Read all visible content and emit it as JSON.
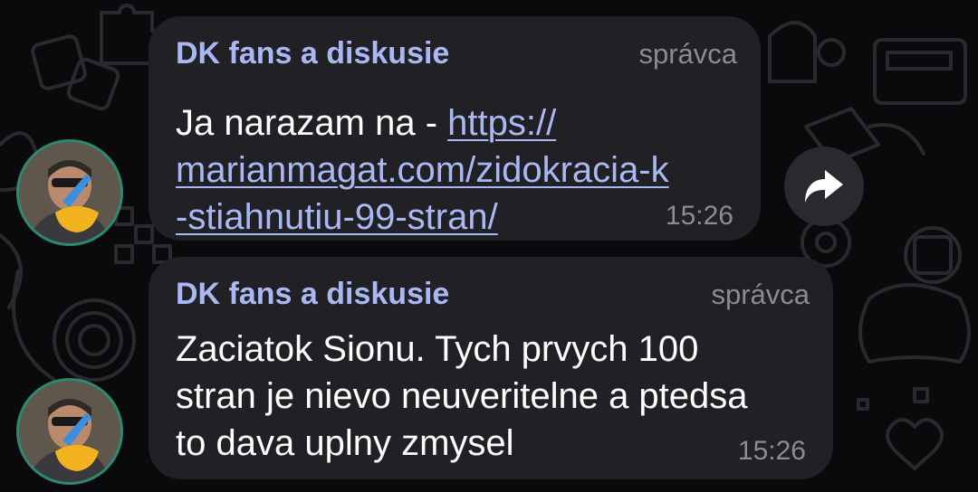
{
  "messages": [
    {
      "sender": "DK fans a diskusie",
      "role": "správca",
      "text_prefix": "Ja narazam na - ",
      "link_lines": [
        "https://",
        "marianmagat.com/zidokracia-k",
        "-stiahnutiu-99-stran/"
      ],
      "time": "15:26"
    },
    {
      "sender": "DK fans a diskusie",
      "role": "správca",
      "text_lines": [
        "Zaciatok Sionu. Tych prvych 100",
        "stran je nievo neuveritelne a ptedsa",
        "to dava uplny zmysel"
      ],
      "time": "15:26"
    }
  ],
  "icons": {
    "forward": "forward-arrow-icon",
    "avatar": "user-avatar"
  },
  "colors": {
    "background": "#0a0a0c",
    "bubble": "#212125",
    "sender_name": "#a9b8f3",
    "link": "#a9b8f3",
    "meta_text": "#8b8b92",
    "message_text": "#ffffff",
    "avatar_ring": "#2b8a72"
  }
}
